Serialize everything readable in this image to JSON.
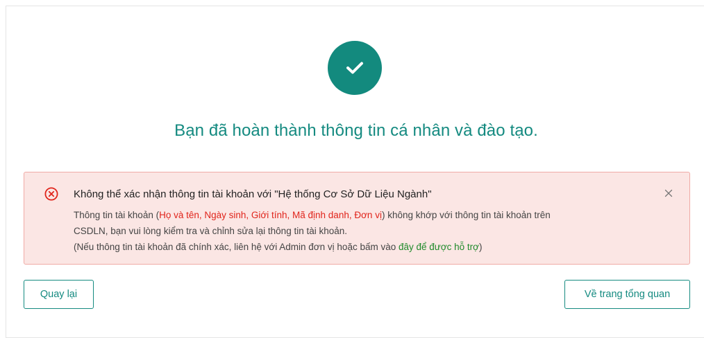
{
  "heading": "Bạn đã hoàn thành thông tin cá nhân và đào tạo.",
  "alert": {
    "title": "Không thể xác nhận thông tin tài khoản với \"Hệ thống Cơ Sở Dữ Liệu Ngành\"",
    "line1_prefix": "Thông tin tài khoản (",
    "line1_fields": "Họ và tên, Ngày sinh, Giới tính, Mã định danh, Đơn vị",
    "line1_suffix": ") không khớp với thông tin tài khoản trên",
    "line2": "CSDLN, bạn vui lòng kiểm tra và chỉnh sửa lại thông tin tài khoản.",
    "line3_prefix": "(Nếu thông tin tài khoản đã chính xác, liên hệ với Admin đơn vị hoặc bấm vào ",
    "line3_link": "đây để được hỗ trợ",
    "line3_suffix": ")"
  },
  "buttons": {
    "back": "Quay lại",
    "overview": "Về trang tổng quan"
  },
  "icons": {
    "success": "check-icon",
    "error": "error-circle-icon",
    "close": "close-icon"
  },
  "colors": {
    "accent": "#138a7e",
    "error": "#e0241b",
    "alert_bg": "#fbe6e4",
    "alert_border": "#f0aaa5",
    "link": "#1f8a2a"
  }
}
